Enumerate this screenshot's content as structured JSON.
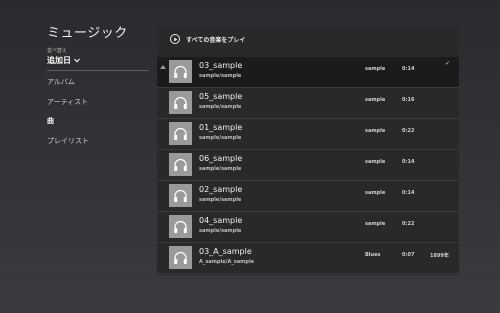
{
  "app_title": "ミュージック",
  "sort": {
    "label": "並べ替え",
    "selected": "追加日",
    "chevron_icon": "chevron-down-icon"
  },
  "nav": [
    {
      "label": "アルバム",
      "active": false
    },
    {
      "label": "アーティスト",
      "active": false
    },
    {
      "label": "曲",
      "active": true
    },
    {
      "label": "プレイリスト",
      "active": false
    }
  ],
  "play_all": {
    "label": "すべての音楽をプレイ",
    "icon": "play-circle-icon"
  },
  "songs": [
    {
      "title": "03_sample",
      "subtitle": "sample/sample",
      "genre": "sample",
      "duration": "0:14",
      "year": "",
      "selected": true,
      "checked": true
    },
    {
      "title": "05_sample",
      "subtitle": "sample/sample",
      "genre": "sample",
      "duration": "0:16",
      "year": "",
      "selected": false,
      "checked": false
    },
    {
      "title": "01_sample",
      "subtitle": "sample/sample",
      "genre": "sample",
      "duration": "0:22",
      "year": "",
      "selected": false,
      "checked": false
    },
    {
      "title": "06_sample",
      "subtitle": "sample/sample",
      "genre": "sample",
      "duration": "0:14",
      "year": "",
      "selected": false,
      "checked": false
    },
    {
      "title": "02_sample",
      "subtitle": "sample/sample",
      "genre": "sample",
      "duration": "0:14",
      "year": "",
      "selected": false,
      "checked": false
    },
    {
      "title": "04_sample",
      "subtitle": "sample/sample",
      "genre": "sample",
      "duration": "0:22",
      "year": "",
      "selected": false,
      "checked": false
    },
    {
      "title": "03_A_sample",
      "subtitle": "A_sample/A_sample",
      "genre": "Blues",
      "duration": "0:07",
      "year": "1899年",
      "selected": false,
      "checked": false
    }
  ],
  "check_glyph": "✓",
  "colors": {
    "background": "#2f3033",
    "panel": "#29292b",
    "selected_row": "#1b1b1c",
    "thumb": "#9a9a9a"
  }
}
